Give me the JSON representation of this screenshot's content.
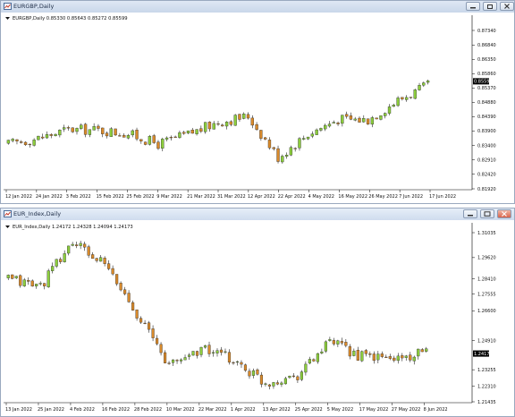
{
  "window1": {
    "title": "EURGBP,Daily",
    "info": "EURGBP,Daily  0.85330 0.85643 0.85272 0.85599",
    "price_labels": [
      "0.87340",
      "0.86840",
      "0.86350",
      "0.85860",
      "0.85370",
      "0.84880",
      "0.84390",
      "0.83900",
      "0.83400",
      "0.82910",
      "0.82420",
      "0.81920"
    ],
    "current_price": "0.85599",
    "date_labels": [
      "12 Jan 2022",
      "24 Jan 2022",
      "3 Feb 2022",
      "15 Feb 2022",
      "25 Feb 2022",
      "9 Mar 2022",
      "21 Mar 2022",
      "31 Mar 2022",
      "12 Apr 2022",
      "22 Apr 2022",
      "4 May 2022",
      "16 May 2022",
      "26 May 2022",
      "7 Jun 2022",
      "17 Jun 2022"
    ]
  },
  "window2": {
    "title": "EUR_Index,Daily",
    "info": "EUR_Index,Daily  1.24172 1.24328 1.24094 1.24173",
    "price_labels": [
      "1.31035",
      "1.29620",
      "1.28410",
      "1.27555",
      "1.26600",
      "1.24910",
      "1.24173",
      "1.23255",
      "1.22310",
      "1.21435"
    ],
    "current_price": "1.24173",
    "date_labels": [
      "13 Jan 2022",
      "25 Jan 2022",
      "4 Feb 2022",
      "16 Feb 2022",
      "28 Feb 2022",
      "10 Mar 2022",
      "22 Mar 2022",
      "1 Apr 2022",
      "13 Apr 2022",
      "25 Apr 2022",
      "5 May 2022",
      "17 May 2022",
      "27 May 2022",
      "8 Jun 2022"
    ]
  },
  "colors": {
    "bull": "#8ccd3c",
    "bear": "#d98a2b",
    "wick": "#222222",
    "axis": "#000000",
    "current_bg": "#000000",
    "current_fg": "#ffffff"
  },
  "icons": {
    "minimize": "minimize-icon",
    "maximize": "maximize-icon",
    "restore": "restore-icon",
    "close": "close-icon",
    "chart": "chart-window-icon"
  },
  "chart_data": [
    {
      "type": "candlestick",
      "title": "EURGBP,Daily",
      "ylim": [
        0.8192,
        0.8734
      ],
      "x": [
        "12 Jan 2022",
        "24 Jan 2022",
        "3 Feb 2022",
        "15 Feb 2022",
        "25 Feb 2022",
        "9 Mar 2022",
        "21 Mar 2022",
        "31 Mar 2022",
        "12 Apr 2022",
        "22 Apr 2022",
        "4 May 2022",
        "16 May 2022",
        "26 May 2022",
        "7 Jun 2022",
        "17 Jun 2022"
      ],
      "close": [
        0.8345,
        0.8365,
        0.8395,
        0.8393,
        0.838,
        0.8345,
        0.8379,
        0.842,
        0.8441,
        0.83,
        0.838,
        0.843,
        0.8428,
        0.8495,
        0.8545
      ],
      "last": 0.85599
    },
    {
      "type": "candlestick",
      "title": "EUR_Index,Daily",
      "ylim": [
        1.21435,
        1.31035
      ],
      "x": [
        "13 Jan 2022",
        "25 Jan 2022",
        "4 Feb 2022",
        "16 Feb 2022",
        "28 Feb 2022",
        "10 Mar 2022",
        "22 Mar 2022",
        "1 Apr 2022",
        "13 Apr 2022",
        "25 Apr 2022",
        "5 May 2022",
        "17 May 2022",
        "27 May 2022",
        "8 Jun 2022"
      ],
      "close": [
        1.284,
        1.28,
        1.305,
        1.292,
        1.265,
        1.235,
        1.245,
        1.238,
        1.225,
        1.23,
        1.248,
        1.24,
        1.239,
        1.2417
      ],
      "last": 1.24173
    }
  ]
}
